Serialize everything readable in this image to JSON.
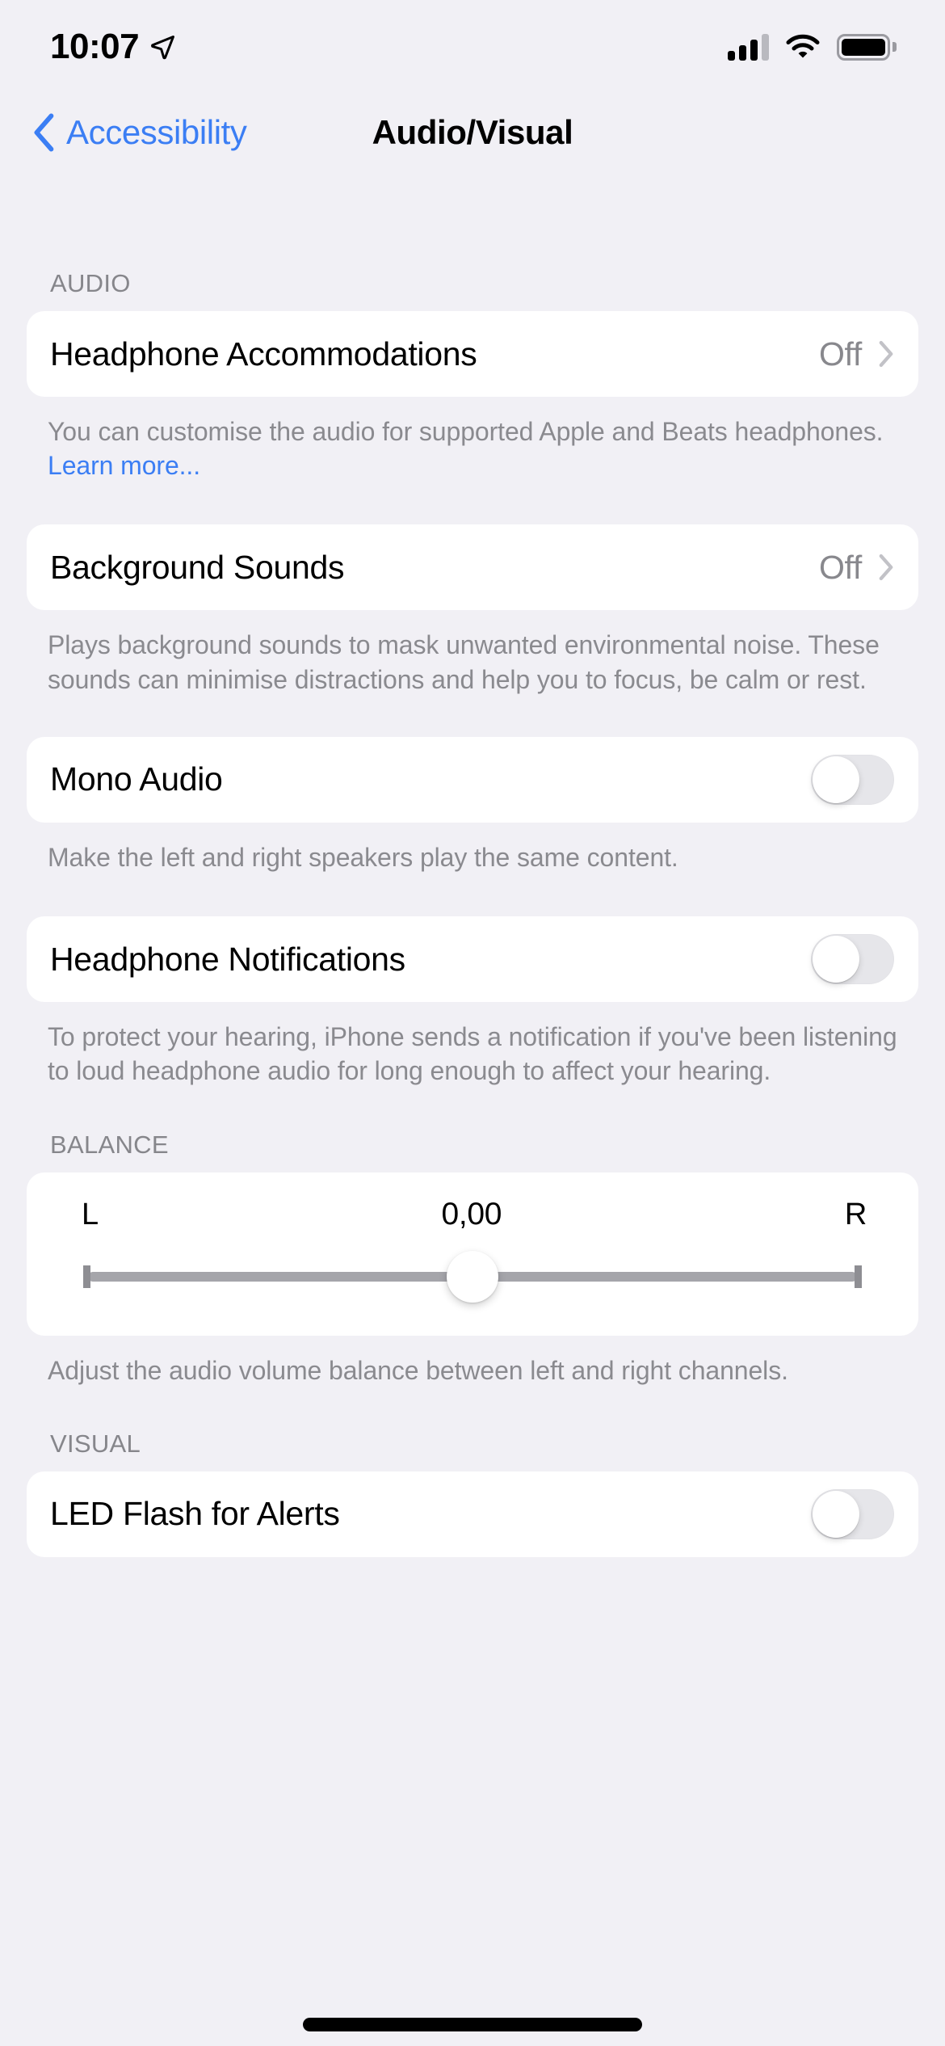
{
  "status_bar": {
    "time": "10:07",
    "location_icon": "location-arrow-icon",
    "cellular_icon": "cellular-signal-icon",
    "cellular_bars_filled": 3,
    "cellular_bars_total": 4,
    "wifi_icon": "wifi-icon",
    "battery_icon": "battery-full-icon"
  },
  "nav": {
    "back_label": "Accessibility",
    "back_icon": "chevron-left-icon",
    "title": "Audio/Visual"
  },
  "sections": {
    "audio": {
      "header": "AUDIO",
      "headphone_accommodations": {
        "label": "Headphone Accommodations",
        "value": "Off",
        "chevron_icon": "chevron-right-icon",
        "footer_before": "You can customise the audio for supported Apple and Beats headphones. ",
        "footer_link": "Learn more..."
      },
      "background_sounds": {
        "label": "Background Sounds",
        "value": "Off",
        "chevron_icon": "chevron-right-icon",
        "footer": "Plays background sounds to mask unwanted environmental noise. These sounds can minimise distractions and help you to focus, be calm or rest."
      },
      "mono_audio": {
        "label": "Mono Audio",
        "toggle_state": "off",
        "footer": "Make the left and right speakers play the same content."
      },
      "headphone_notifications": {
        "label": "Headphone Notifications",
        "toggle_state": "off",
        "footer": "To protect your hearing, iPhone sends a notification if you've been listening to loud headphone audio for long enough to affect your hearing."
      }
    },
    "balance": {
      "header": "BALANCE",
      "left_label": "L",
      "value": "0,00",
      "right_label": "R",
      "slider_position_percent": 50,
      "footer": "Adjust the audio volume balance between left and right channels."
    },
    "visual": {
      "header": "VISUAL",
      "led_flash": {
        "label": "LED Flash for Alerts",
        "toggle_state": "off"
      }
    }
  },
  "colors": {
    "background": "#f1f0f5",
    "card": "#ffffff",
    "accent_blue": "#3b7ef4",
    "secondary_text": "#8a8a8f",
    "toggle_off_track": "#e6e6ea"
  }
}
